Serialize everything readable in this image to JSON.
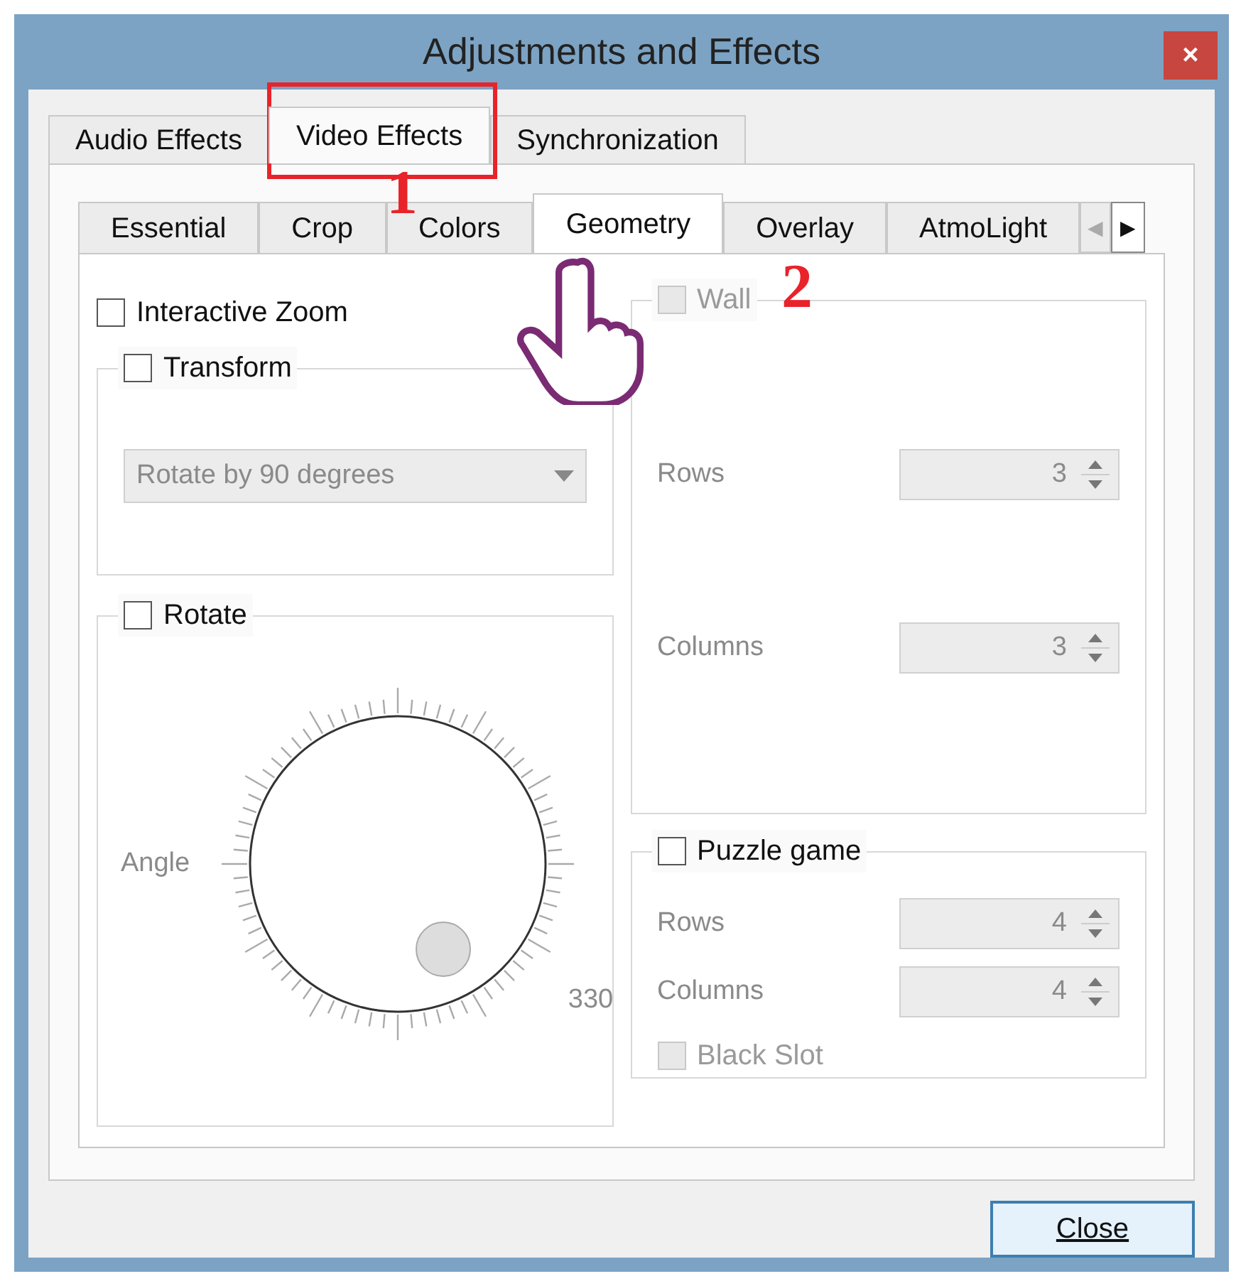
{
  "window": {
    "title": "Adjustments and Effects",
    "close": "×"
  },
  "tabs": [
    {
      "label": "Audio Effects",
      "selected": false
    },
    {
      "label": "Video Effects",
      "selected": true
    },
    {
      "label": "Synchronization",
      "selected": false
    }
  ],
  "subtabs": [
    {
      "label": "Essential",
      "selected": false
    },
    {
      "label": "Crop",
      "selected": false
    },
    {
      "label": "Colors",
      "selected": false
    },
    {
      "label": "Geometry",
      "selected": true
    },
    {
      "label": "Overlay",
      "selected": false
    },
    {
      "label": "AtmoLight",
      "selected": false
    }
  ],
  "subtab_scroll": {
    "left": "◀",
    "right": "▶"
  },
  "interactive_zoom": {
    "label": "Interactive Zoom",
    "checked": false
  },
  "transform": {
    "label": "Transform",
    "checked": false,
    "dropdown": "Rotate by 90 degrees",
    "disabled": true
  },
  "rotate": {
    "label": "Rotate",
    "checked": false,
    "angle_label": "Angle",
    "reading": "330",
    "disabled": true
  },
  "wall": {
    "label": "Wall",
    "checked": false,
    "disabled": true,
    "fields": [
      {
        "label": "Rows",
        "value": "3"
      },
      {
        "label": "Columns",
        "value": "3"
      }
    ]
  },
  "puzzle": {
    "label": "Puzzle game",
    "checked": false,
    "disabled": true,
    "fields": [
      {
        "label": "Rows",
        "value": "4"
      },
      {
        "label": "Columns",
        "value": "4"
      }
    ],
    "black_slot": {
      "label": "Black Slot",
      "checked": false,
      "disabled": true
    }
  },
  "buttons": [
    {
      "label": "Close"
    }
  ],
  "annotations": [
    {
      "text": "1"
    },
    {
      "text": "2"
    }
  ]
}
